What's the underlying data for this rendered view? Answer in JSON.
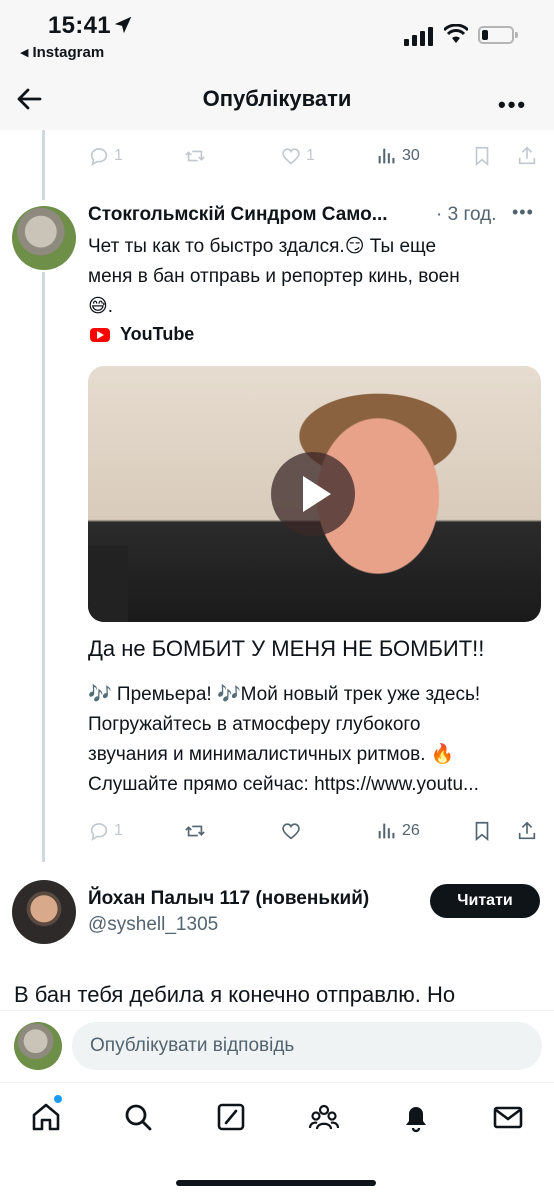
{
  "status_bar": {
    "time": "15:41",
    "back_app": "Instagram",
    "battery_level": 0.2
  },
  "header": {
    "title": "Опублікувати"
  },
  "previous_tweet": {
    "actions": {
      "replies": "1",
      "likes": "1",
      "views": "30"
    }
  },
  "tweet": {
    "author": "Стокгольмскій Синдром Само...",
    "time": "· 3 год.",
    "text_lines": [
      "Чет ты как то быстро здался.😏 Ты еще",
      "меня в бан отправь и репортер кинь, воен",
      "😅."
    ],
    "card": {
      "source": "YouTube",
      "title": "Да не БОМБИТ У МЕНЯ НЕ БОМБИТ!!",
      "desc_lines": [
        "🎶 Премьера! 🎶Мой новый трек уже здесь!",
        "Погружайтесь в атмосферу глубокого",
        "звучания и минималистичных ритмов. 🔥",
        "Слушайте прямо сейчас: https://www.youtu..."
      ]
    },
    "actions": {
      "replies": "1",
      "views": "26"
    }
  },
  "reply_user": {
    "name": "Йохан Палыч 117 (новенький)",
    "handle": "@syshell_1305",
    "follow_label": "Читати",
    "text": "В бан тебя дебила я конечно отправлю. Но"
  },
  "composer": {
    "placeholder": "Опублікувати відповідь"
  },
  "bottom_nav": {
    "items": [
      "home-icon",
      "search-icon",
      "compose-icon",
      "communities-icon",
      "notifications-icon",
      "messages-icon"
    ]
  }
}
